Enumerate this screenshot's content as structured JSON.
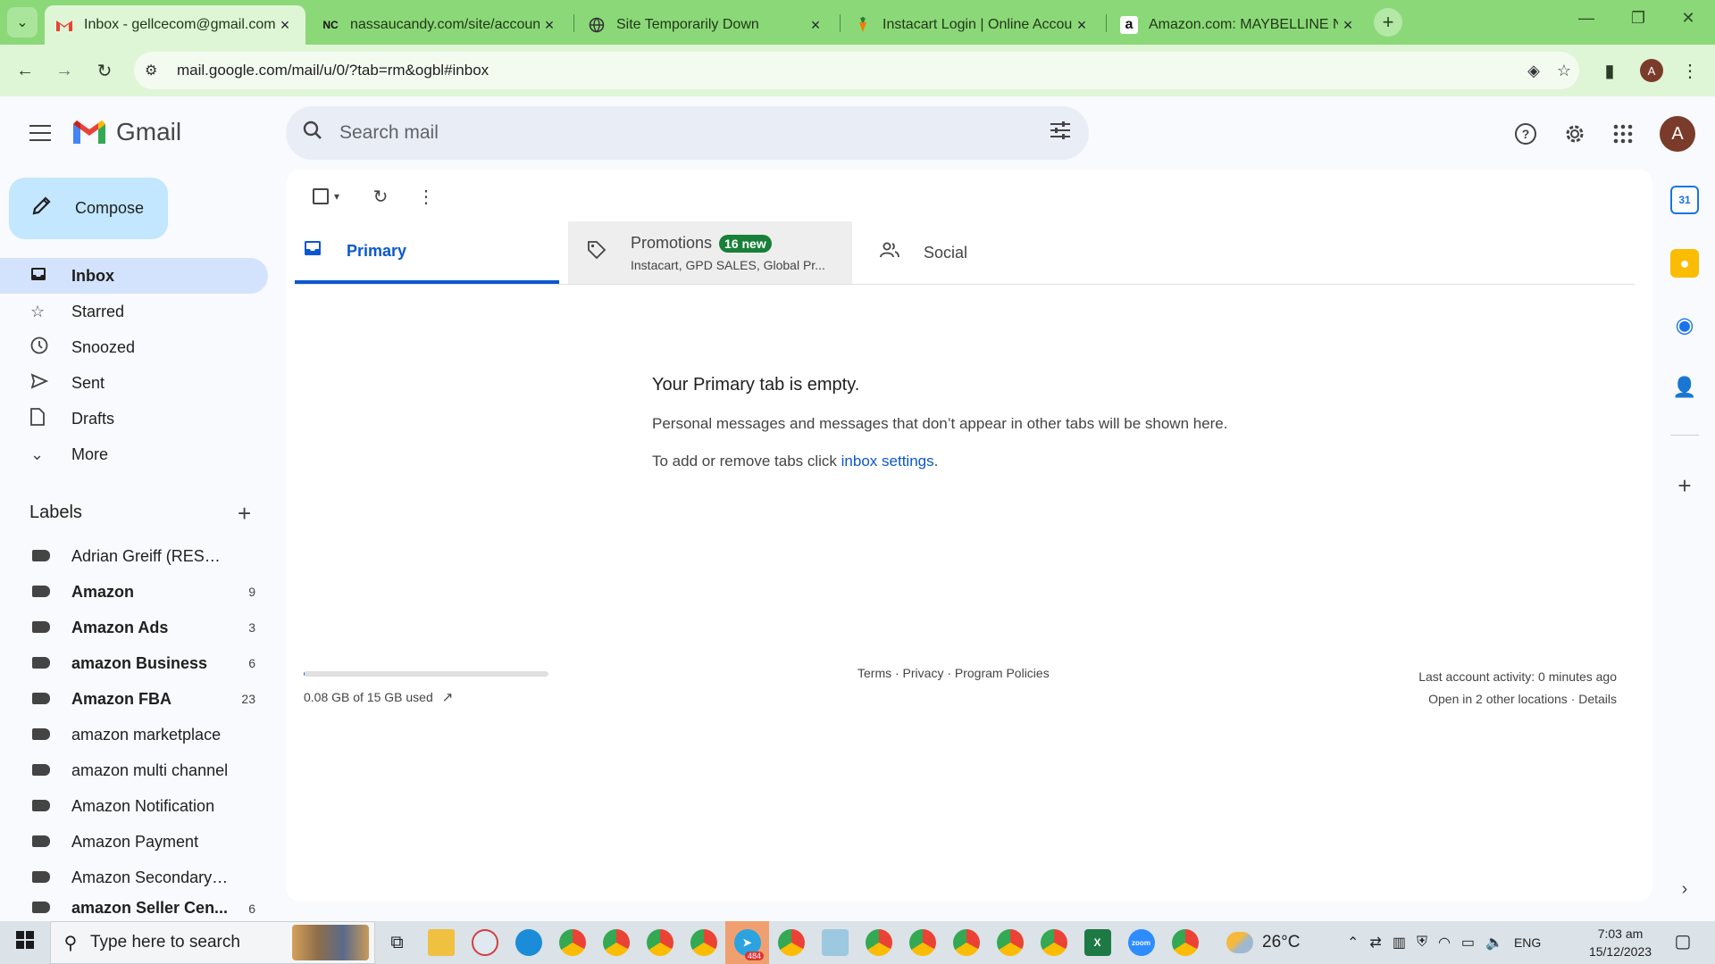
{
  "browser": {
    "tabs": [
      {
        "title": "Inbox - gellcecom@gmail.com",
        "favicon": "gmail-icon",
        "active": true
      },
      {
        "title": "nassaucandy.com/site/account/",
        "favicon": "nc-icon",
        "favicon_text": "NC",
        "active": false
      },
      {
        "title": "Site Temporarily Down",
        "favicon": "globe-icon",
        "active": false
      },
      {
        "title": "Instacart Login | Online Account",
        "favicon": "carrot-icon",
        "active": false
      },
      {
        "title": "Amazon.com: MAYBELLINE New",
        "favicon": "amazon-icon",
        "favicon_text": "a",
        "active": false
      }
    ],
    "url": "mail.google.com/mail/u/0/?tab=rm&ogbl#inbox",
    "profile_initial": "A",
    "accent": "#8bd878"
  },
  "gmail": {
    "brand": "Gmail",
    "search_placeholder": "Search mail",
    "account_initial": "A",
    "compose_label": "Compose",
    "nav": [
      {
        "label": "Inbox",
        "icon": "inbox-icon",
        "active": true
      },
      {
        "label": "Starred",
        "icon": "star-icon"
      },
      {
        "label": "Snoozed",
        "icon": "clock-icon"
      },
      {
        "label": "Sent",
        "icon": "send-icon"
      },
      {
        "label": "Drafts",
        "icon": "draft-icon"
      },
      {
        "label": "More",
        "icon": "chevron-down-icon"
      }
    ],
    "labels_heading": "Labels",
    "labels": [
      {
        "name": "Adrian Greiff (RESALE C...",
        "count": "",
        "bold": false
      },
      {
        "name": "Amazon",
        "count": "9",
        "bold": true
      },
      {
        "name": "Amazon Ads",
        "count": "3",
        "bold": true
      },
      {
        "name": "amazon Business",
        "count": "6",
        "bold": true
      },
      {
        "name": "Amazon FBA",
        "count": "23",
        "bold": true
      },
      {
        "name": "amazon marketplace",
        "count": "",
        "bold": false
      },
      {
        "name": "amazon multi channel",
        "count": "",
        "bold": false
      },
      {
        "name": "Amazon Notification",
        "count": "",
        "bold": false
      },
      {
        "name": "Amazon Payment",
        "count": "",
        "bold": false
      },
      {
        "name": "Amazon Secondary Invit...",
        "count": "",
        "bold": false
      },
      {
        "name": "amazon Seller Cen...",
        "count": "6",
        "bold": true
      }
    ],
    "inbox_tabs": {
      "primary": "Primary",
      "promotions": "Promotions",
      "promotions_badge": "16 new",
      "promotions_sub": "Instacart, GPD SALES, Global Pr...",
      "social": "Social"
    },
    "empty": {
      "heading": "Your Primary tab is empty.",
      "line1": "Personal messages and messages that don’t appear in other tabs will be shown here.",
      "line2_prefix": "To add or remove tabs click ",
      "line2_link": "inbox settings",
      "line2_suffix": "."
    },
    "footer": {
      "storage": "0.08 GB of 15 GB used",
      "storage_fraction": 0.005,
      "links": "Terms · Privacy · Program Policies",
      "activity": "Last account activity: 0 minutes ago",
      "locations": "Open in 2 other locations · Details"
    }
  },
  "taskbar": {
    "search_placeholder": "Type here to search",
    "telegram_badge": "484",
    "temperature": "26°C",
    "language": "ENG",
    "time": "7:03 am",
    "date": "15/12/2023"
  }
}
